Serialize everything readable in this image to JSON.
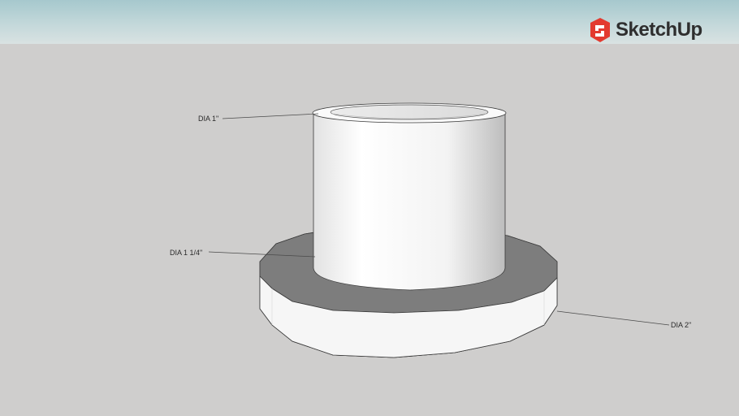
{
  "brand": {
    "name": "SketchUp",
    "logo_color": "#e33a2f"
  },
  "scene": {
    "sky_color": "#b9d2d5",
    "ground_color": "#cfcecd"
  },
  "dimensions": [
    {
      "label": "DIA 1\""
    },
    {
      "label": "DIA 1 1/4\""
    },
    {
      "label": "DIA 2\""
    }
  ]
}
